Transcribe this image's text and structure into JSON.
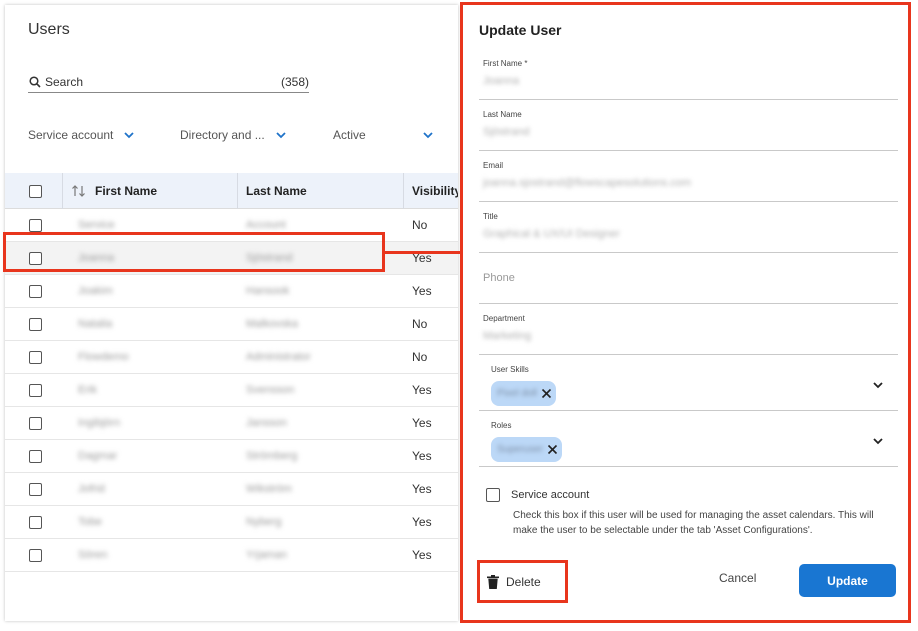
{
  "users": {
    "title": "Users",
    "search": {
      "label": "Search",
      "count": "(358)"
    },
    "filters": [
      {
        "label": "Service account"
      },
      {
        "label": "Directory and ..."
      },
      {
        "label": "Active"
      }
    ],
    "columns": {
      "first_name": "First Name",
      "last_name": "Last Name",
      "visibility": "Visibility"
    },
    "rows": [
      {
        "first": "Service",
        "last": "Account",
        "visibility": "No"
      },
      {
        "first": "Joanna",
        "last": "Sjöstrand",
        "visibility": "Yes"
      },
      {
        "first": "Joakim",
        "last": "Hansook",
        "visibility": "Yes"
      },
      {
        "first": "Natalia",
        "last": "Malkovska",
        "visibility": "No"
      },
      {
        "first": "Flowdemo",
        "last": "Administrator",
        "visibility": "No"
      },
      {
        "first": "Erik",
        "last": "Svensson",
        "visibility": "Yes"
      },
      {
        "first": "Ingibjörn",
        "last": "Jansson",
        "visibility": "Yes"
      },
      {
        "first": "Dagmar",
        "last": "Strömberg",
        "visibility": "Yes"
      },
      {
        "first": "Jofrid",
        "last": "Wikström",
        "visibility": "Yes"
      },
      {
        "first": "Tobe",
        "last": "Nyberg",
        "visibility": "Yes"
      },
      {
        "first": "Sören",
        "last": "Yrjaman",
        "visibility": "Yes"
      }
    ]
  },
  "update_user": {
    "title": "Update User",
    "fields": {
      "first_name": {
        "label": "First Name *",
        "value": "Joanna"
      },
      "last_name": {
        "label": "Last Name",
        "value": "Sjöstrand"
      },
      "email": {
        "label": "Email",
        "value": "joanna.sjostrand@flowscapesolutions.com"
      },
      "title": {
        "label": "Title",
        "value": "Graphical & UX/UI Designer"
      },
      "phone": {
        "placeholder": "Phone"
      },
      "department": {
        "label": "Department",
        "value": "Marketing"
      }
    },
    "user_skills": {
      "label": "User Skills",
      "chip": "Pixel doll"
    },
    "roles": {
      "label": "Roles",
      "chip": "Superuser"
    },
    "service_account": {
      "label": "Service account",
      "help": "Check this box if this user will be used for managing the asset calendars. This will make the user to be selectable under the tab 'Asset Configurations'."
    },
    "buttons": {
      "delete": "Delete",
      "cancel": "Cancel",
      "update": "Update"
    }
  },
  "colors": {
    "highlight": "#e8351d",
    "primary": "#1976d2",
    "chip": "#bcd8f7",
    "header_bg": "#edf2fa"
  }
}
